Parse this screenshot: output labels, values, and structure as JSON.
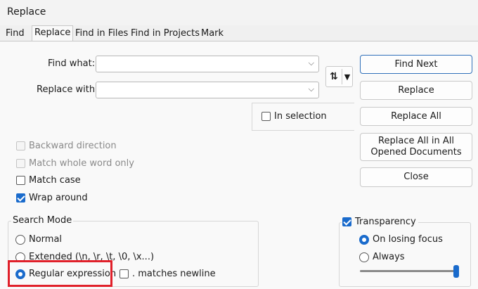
{
  "window": {
    "title": "Replace"
  },
  "tabs": [
    {
      "label": "Find"
    },
    {
      "label": "Replace"
    },
    {
      "label": "Find in Files"
    },
    {
      "label": "Find in Projects"
    },
    {
      "label": "Mark"
    }
  ],
  "find": {
    "label": "Find what:",
    "value": ""
  },
  "replace": {
    "label": "Replace with:",
    "value": ""
  },
  "buttons": {
    "find_next": "Find Next",
    "replace": "Replace",
    "replace_all": "Replace All",
    "replace_all_opened": "Replace All in All Opened Documents",
    "close": "Close",
    "swap_icon": "⇅",
    "swap_dropdown": "▼"
  },
  "options": {
    "in_selection": "In selection",
    "backward": "Backward direction",
    "whole_word": "Match whole word only",
    "match_case": "Match case",
    "wrap_around": "Wrap around"
  },
  "search_mode": {
    "title": "Search Mode",
    "normal": "Normal",
    "extended": "Extended (\\n, \\r, \\t, \\0, \\x...)",
    "regex": "Regular expression",
    "matches_newline": ". matches newline",
    "selected": "Regular expression"
  },
  "transparency": {
    "label": "Transparency",
    "on_losing_focus": "On losing focus",
    "always": "Always",
    "enabled": true,
    "selected": "On losing focus",
    "level": 0.95
  },
  "colors": {
    "accent": "#1a6bcc",
    "highlight": "#e0202a"
  }
}
